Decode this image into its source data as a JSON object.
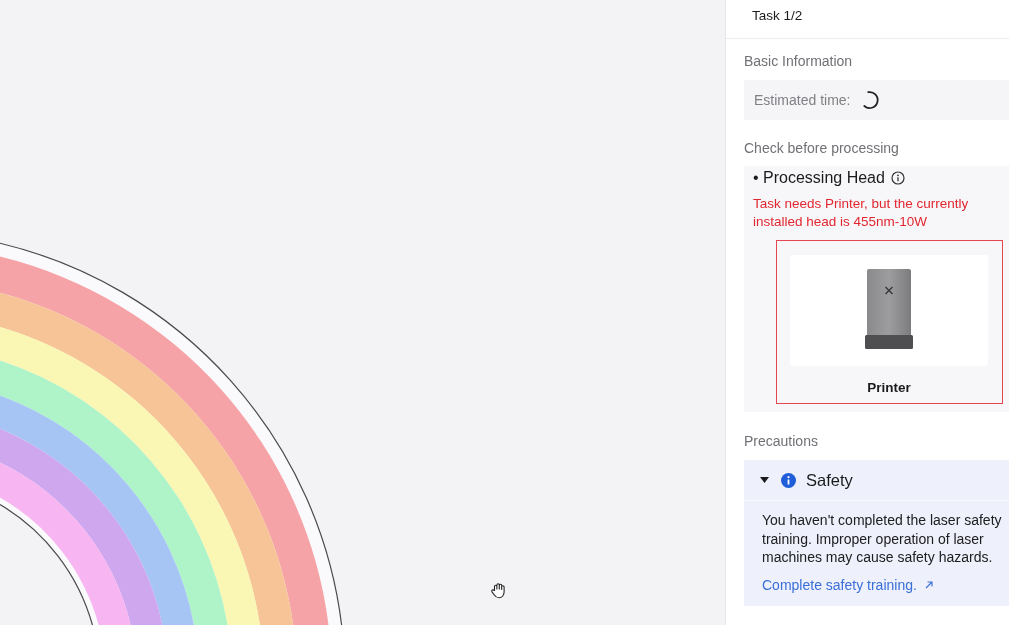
{
  "canvas": {
    "objects": [
      {
        "kind": "rainbow"
      }
    ]
  },
  "panel": {
    "title": "Task 1/2"
  },
  "basic_information": {
    "heading": "Basic Information",
    "fields": [
      {
        "label": "Estimated time:",
        "loading": true
      }
    ]
  },
  "check_before_processing": {
    "heading": "Check before processing",
    "items": [
      {
        "title": "• Processing Head",
        "error": "Task needs Printer, but the currently installed head is 455nm-10W",
        "required_head": {
          "label": "Printer",
          "mismatch": true
        }
      }
    ]
  },
  "precautions": {
    "heading": "Precautions",
    "items": [
      {
        "title": "Safety",
        "expanded": true,
        "message": "You haven't completed the laser safety training. Improper operation of laser machines may cause safety hazards.",
        "link": "Complete safety training."
      }
    ]
  }
}
